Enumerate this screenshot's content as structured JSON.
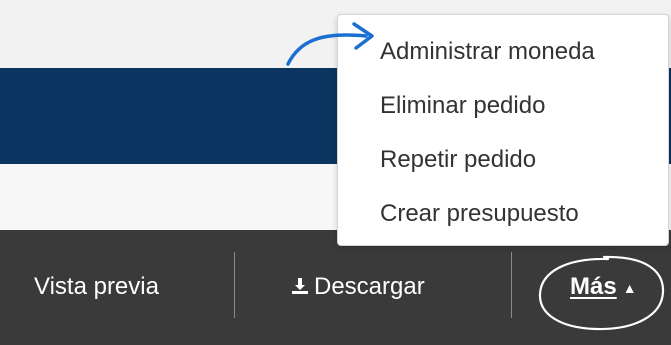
{
  "menu": {
    "items": [
      {
        "label": "Administrar moneda"
      },
      {
        "label": "Eliminar pedido"
      },
      {
        "label": "Repetir pedido"
      },
      {
        "label": "Crear presupuesto"
      }
    ]
  },
  "toolbar": {
    "preview_label": "Vista previa",
    "download_label": "Descargar",
    "more_label": "Más"
  },
  "colors": {
    "navy": "#0b3560",
    "toolbar_bg": "#3a3a3a",
    "annotation_blue": "#1a6fd1"
  },
  "icons": {
    "download": "download-icon",
    "caret": "caret-up-icon"
  }
}
